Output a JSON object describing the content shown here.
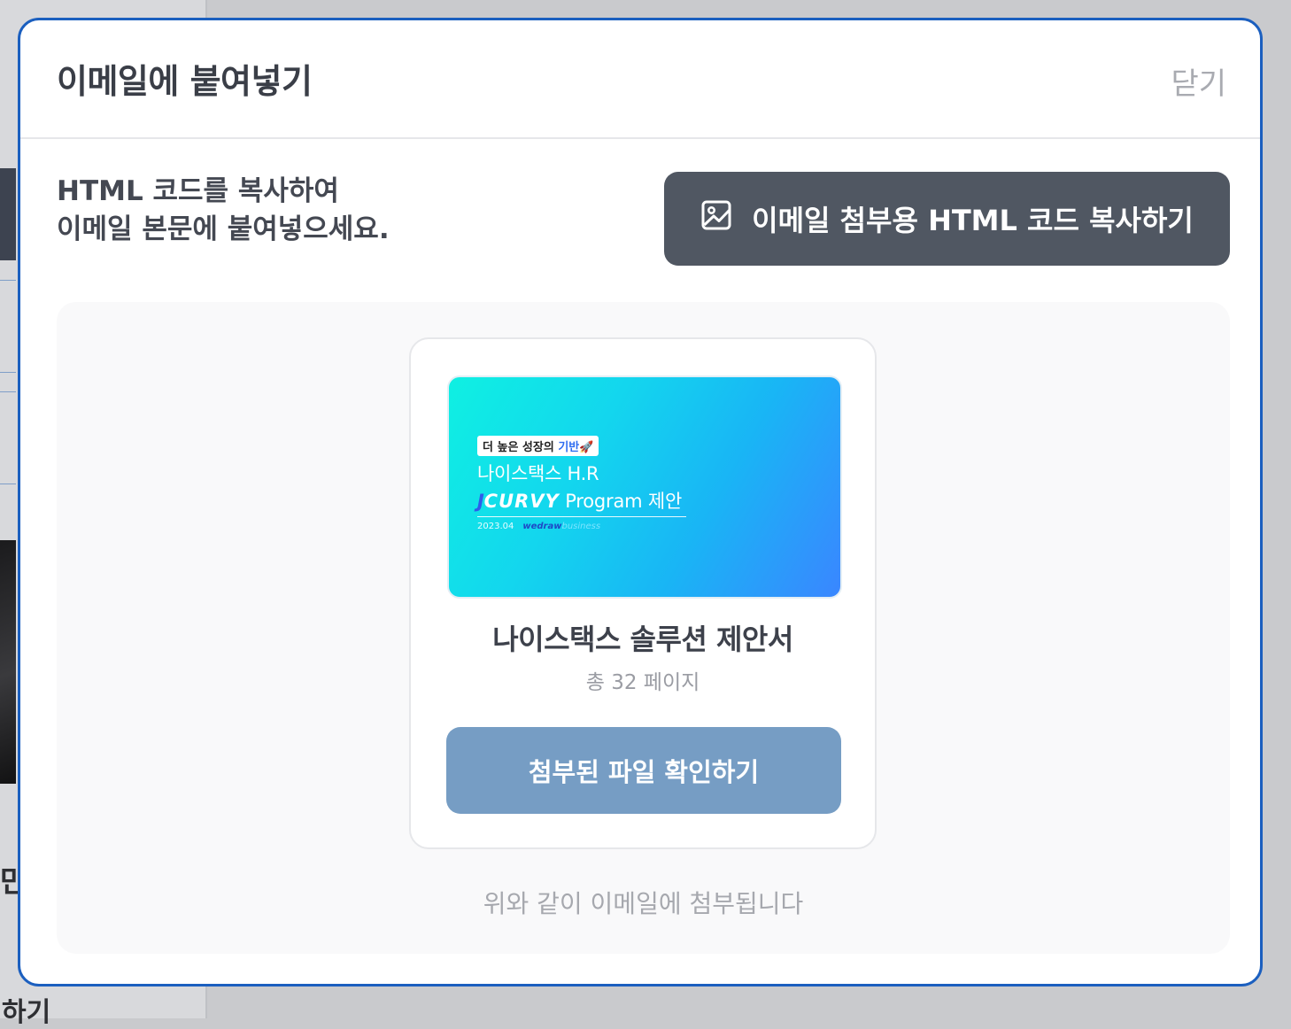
{
  "background": {
    "fragment_text": "만",
    "bottom_text": "하기"
  },
  "modal": {
    "title": "이메일에 붙여넣기",
    "close_label": "닫기",
    "instruction_line1": "HTML 코드를 복사하여",
    "instruction_line2": "이메일 본문에 붙여넣으세요.",
    "copy_button_label": "이메일 첨부용 HTML 코드 복사하기",
    "copy_button_icon": "image-icon",
    "card": {
      "thumbnail": {
        "tag_text": "더 높은 성장의",
        "tag_accent": "기반",
        "tag_emoji": "🚀",
        "line1": "나이스택스 H.R",
        "brand_j": "J",
        "brand": "CURVY",
        "line2_rest": "Program 제안",
        "date": "2023.04",
        "logo": "wedraw",
        "logo2": "business"
      },
      "title": "나이스택스 솔루션 제안서",
      "pages": "총 32 페이지",
      "view_button_label": "첨부된 파일 확인하기"
    },
    "footnote": "위와 같이 이메일에 첨부됩니다"
  },
  "colors": {
    "modal_border": "#1b5fbf",
    "copy_button": "#505762",
    "view_button": "#769dc4"
  }
}
